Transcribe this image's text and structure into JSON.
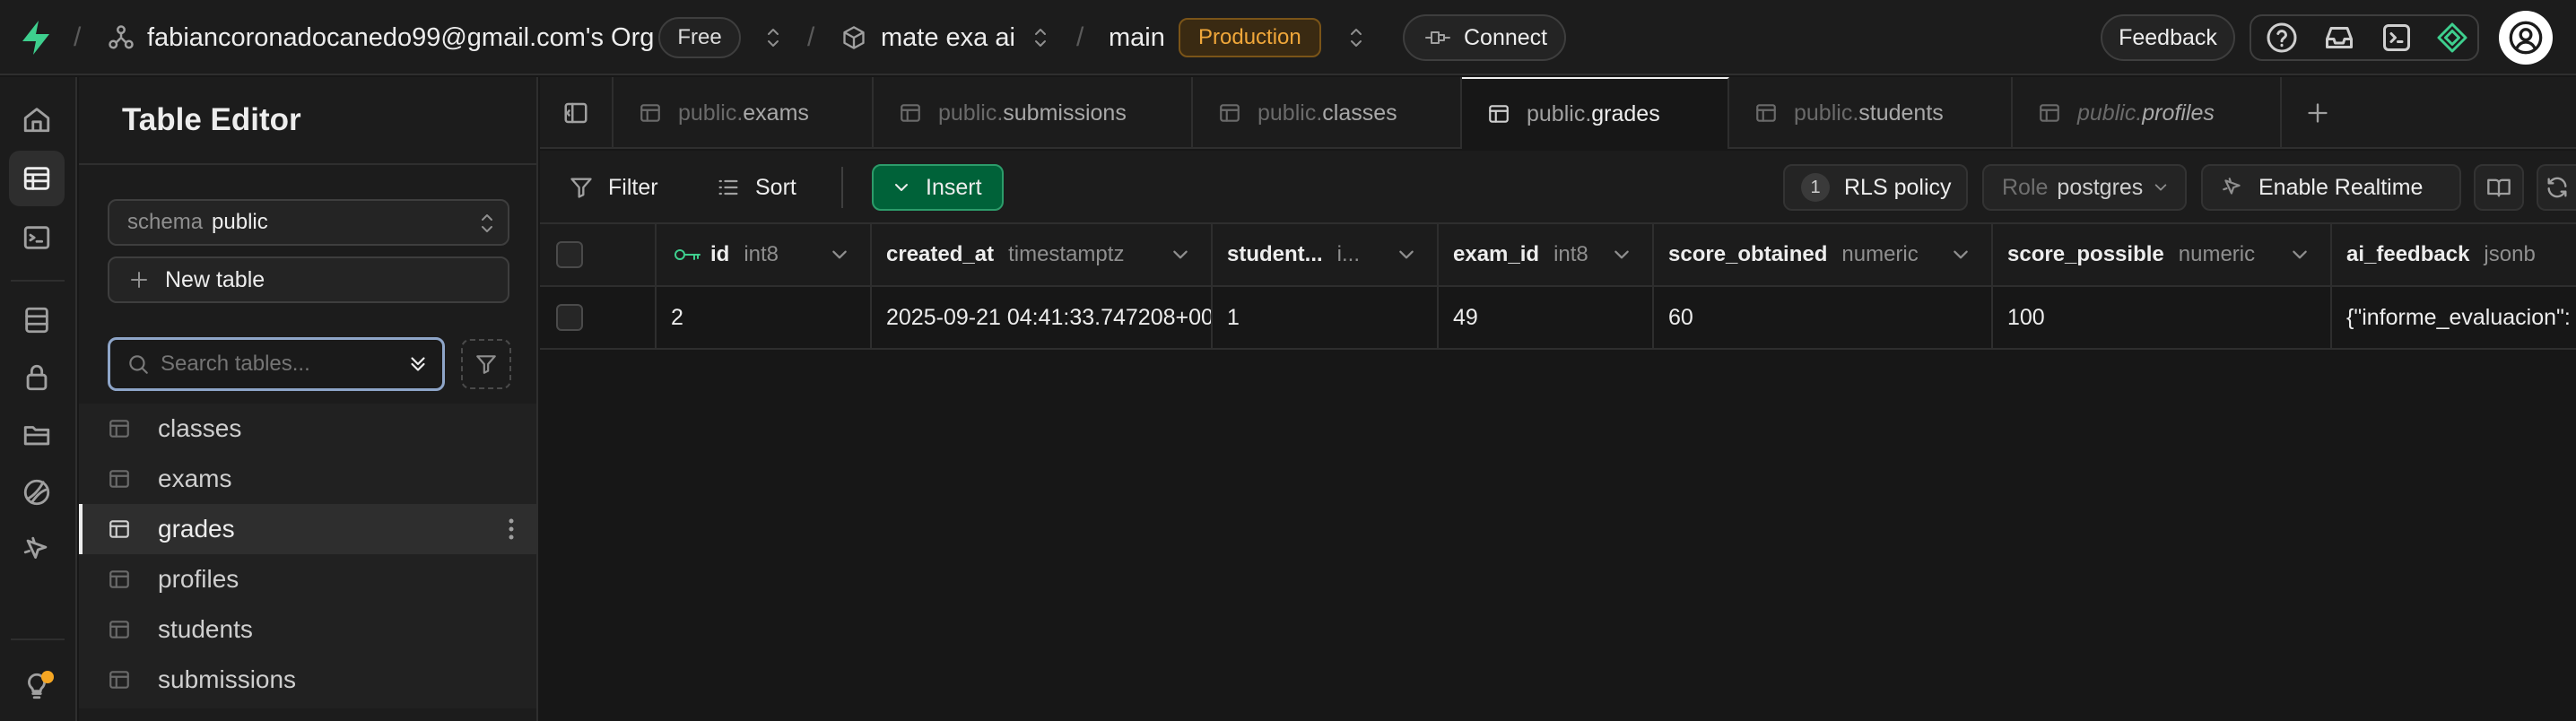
{
  "topbar": {
    "org_name": "fabiancoronadocanedo99@gmail.com's Org",
    "plan_badge": "Free",
    "project_name": "mate exa ai",
    "branch_name": "main",
    "env_badge": "Production",
    "connect_label": "Connect",
    "feedback_label": "Feedback"
  },
  "sidebar": {
    "title": "Table Editor",
    "schema_prefix": "schema",
    "schema_value": "public",
    "new_table_label": "New table",
    "search_placeholder": "Search tables...",
    "tables": [
      {
        "label": "classes",
        "active": false
      },
      {
        "label": "exams",
        "active": false
      },
      {
        "label": "grades",
        "active": true
      },
      {
        "label": "profiles",
        "active": false
      },
      {
        "label": "students",
        "active": false
      },
      {
        "label": "submissions",
        "active": false
      }
    ]
  },
  "tabs": [
    {
      "schema": "public.",
      "name": "exams",
      "active": false
    },
    {
      "schema": "public.",
      "name": "submissions",
      "active": false
    },
    {
      "schema": "public.",
      "name": "classes",
      "active": false
    },
    {
      "schema": "public.",
      "name": "grades",
      "active": true
    },
    {
      "schema": "public.",
      "name": "students",
      "active": false
    },
    {
      "schema": "public.",
      "name": "profiles",
      "active": false
    }
  ],
  "toolbar": {
    "filter_label": "Filter",
    "sort_label": "Sort",
    "insert_label": "Insert",
    "rls_count": "1",
    "rls_label": "RLS policy",
    "role_prefix": "Role",
    "role_value": "postgres",
    "realtime_label": "Enable Realtime"
  },
  "grid": {
    "columns": [
      {
        "name": "id",
        "type": "int8"
      },
      {
        "name": "created_at",
        "type": "timestamptz"
      },
      {
        "name": "student...",
        "type": "i..."
      },
      {
        "name": "exam_id",
        "type": "int8"
      },
      {
        "name": "score_obtained",
        "type": "numeric"
      },
      {
        "name": "score_possible",
        "type": "numeric"
      },
      {
        "name": "ai_feedback",
        "type": "jsonb"
      }
    ],
    "rows": [
      [
        "2",
        "2025-09-21 04:41:33.747208+00",
        "1",
        "49",
        "60",
        "100",
        "{\"informe_evaluacion\":"
      ]
    ]
  },
  "colors": {
    "brand_green": "#3ecf8e",
    "insert_green": "#006239",
    "production_amber": "#f0a73a",
    "notification_orange": "#f5a623"
  }
}
